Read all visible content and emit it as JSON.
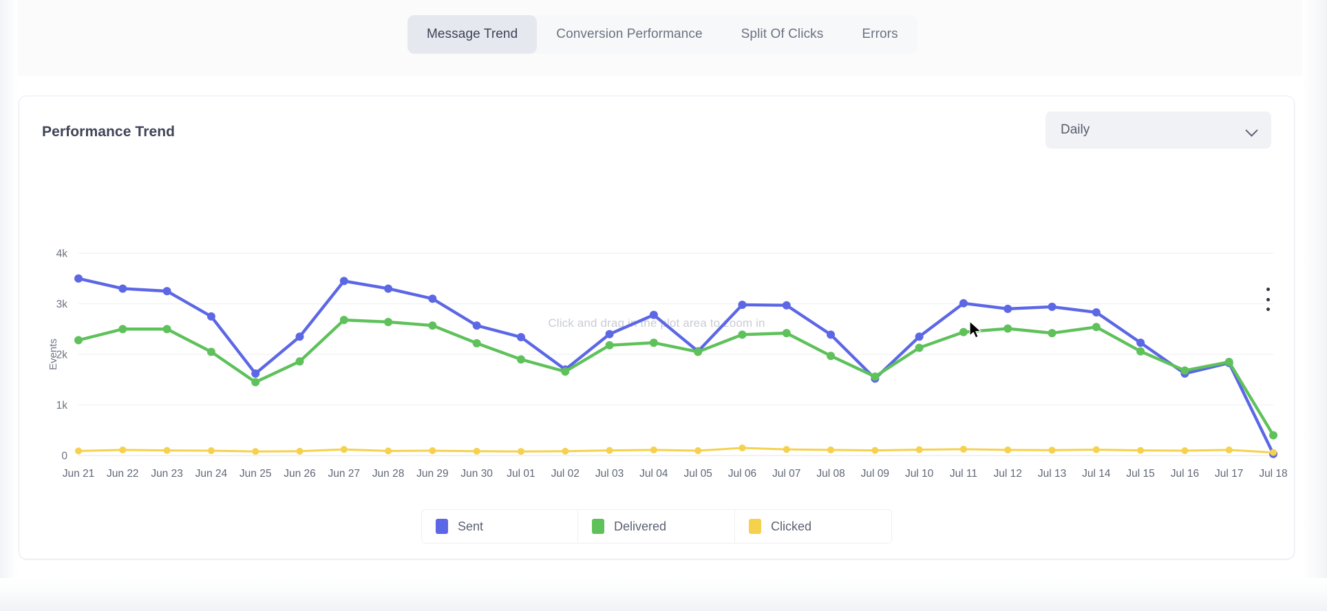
{
  "tabs": [
    {
      "label": "Message Trend",
      "active": true
    },
    {
      "label": "Conversion Performance",
      "active": false
    },
    {
      "label": "Split Of Clicks",
      "active": false
    },
    {
      "label": "Errors",
      "active": false
    }
  ],
  "card": {
    "title": "Performance Trend",
    "period_selected": "Daily",
    "zoom_hint": "Click and drag in the plot area to zoom in",
    "menu_icon": "kebab-menu-icon",
    "chevron_icon": "chevron-down-icon"
  },
  "legend": [
    {
      "label": "Sent",
      "color": "#5c67e5"
    },
    {
      "label": "Delivered",
      "color": "#5ec15a"
    },
    {
      "label": "Clicked",
      "color": "#f5d14e"
    }
  ],
  "chart_data": {
    "type": "line",
    "title": "Performance Trend",
    "xlabel": "",
    "ylabel": "Events",
    "ylim": [
      0,
      4000
    ],
    "yticks": [
      0,
      1000,
      2000,
      3000,
      4000
    ],
    "yticklabels": [
      "0",
      "1k",
      "2k",
      "3k",
      "4k"
    ],
    "grid": true,
    "legend_position": "bottom",
    "annotation": "Click and drag in the plot area to zoom in",
    "categories": [
      "Jun 21",
      "Jun 22",
      "Jun 23",
      "Jun 24",
      "Jun 25",
      "Jun 26",
      "Jun 27",
      "Jun 28",
      "Jun 29",
      "Jun 30",
      "Jul 01",
      "Jul 02",
      "Jul 03",
      "Jul 04",
      "Jul 05",
      "Jul 06",
      "Jul 07",
      "Jul 08",
      "Jul 09",
      "Jul 10",
      "Jul 11",
      "Jul 12",
      "Jul 13",
      "Jul 14",
      "Jul 15",
      "Jul 16",
      "Jul 17",
      "Jul 18"
    ],
    "series": [
      {
        "name": "Sent",
        "color": "#5c67e5",
        "values": [
          3500,
          3300,
          3250,
          2750,
          1620,
          2350,
          3450,
          3300,
          3100,
          2570,
          2340,
          1700,
          2400,
          2780,
          2060,
          2980,
          2970,
          2390,
          1520,
          2350,
          3010,
          2900,
          2940,
          2830,
          2230,
          1620,
          1830,
          30
        ]
      },
      {
        "name": "Delivered",
        "color": "#5ec15a",
        "values": [
          2280,
          2500,
          2500,
          2050,
          1450,
          1860,
          2680,
          2640,
          2570,
          2220,
          1900,
          1660,
          2180,
          2230,
          2050,
          2390,
          2420,
          1970,
          1560,
          2130,
          2440,
          2510,
          2420,
          2540,
          2060,
          1680,
          1850,
          400
        ]
      },
      {
        "name": "Clicked",
        "color": "#f5d14e",
        "values": [
          90,
          110,
          100,
          95,
          80,
          85,
          120,
          90,
          95,
          85,
          80,
          85,
          100,
          110,
          95,
          150,
          120,
          110,
          100,
          115,
          125,
          110,
          105,
          115,
          100,
          95,
          110,
          60
        ]
      }
    ]
  }
}
